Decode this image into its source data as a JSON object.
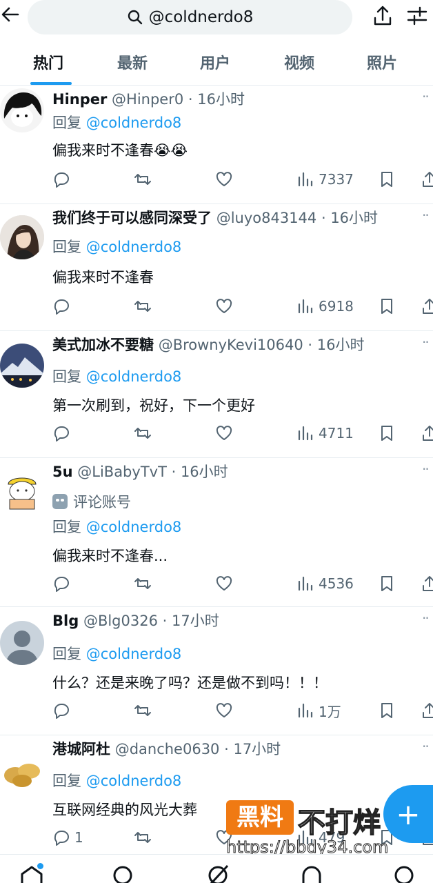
{
  "search": {
    "query": "@coldnerdo8"
  },
  "tabs": [
    "热门",
    "最新",
    "用户",
    "视频",
    "照片"
  ],
  "tweets": [
    {
      "name": "Hinper",
      "handle": "@Hinper0",
      "time": "16小时",
      "reply_prefix": "回复",
      "reply_to": "@coldnerdo8",
      "text": "偏我来时不逢春😭😭",
      "views": "7337",
      "replies": ""
    },
    {
      "name": "我们终于可以感同深受了",
      "handle": "@luyo843144",
      "time": "16小时",
      "reply_prefix": "回复",
      "reply_to": "@coldnerdo8",
      "text": "偏我来时不逢春",
      "views": "6918",
      "replies": ""
    },
    {
      "name": "美式加冰不要糖",
      "handle": "@BrownyKevi10640",
      "time": "16小时",
      "reply_prefix": "回复",
      "reply_to": "@coldnerdo8",
      "text": "第一次刷到，祝好，下一个更好",
      "views": "4711",
      "replies": ""
    },
    {
      "name": "5u",
      "handle": "@LiBabyTvT",
      "time": "16小时",
      "label": "评论账号",
      "reply_prefix": "回复",
      "reply_to": "@coldnerdo8",
      "text": "偏我来时不逢春...",
      "views": "4536",
      "replies": ""
    },
    {
      "name": "Blg",
      "handle": "@Blg0326",
      "time": "17小时",
      "reply_prefix": "回复",
      "reply_to": "@coldnerdo8",
      "text": "什么？还是来晚了吗？还是做不到吗！！！",
      "views": "1万",
      "replies": ""
    },
    {
      "name": "港城阿杜",
      "handle": "@danche0630",
      "time": "17小时",
      "reply_prefix": "回复",
      "reply_to": "@coldnerdo8",
      "text": "互联网经典的风光大葬",
      "views": "479",
      "replies": "1"
    }
  ],
  "fab": {
    "label": "+"
  },
  "watermark": {
    "box": "黑料",
    "big": "不打烊",
    "url": "https://bbdy34.com"
  },
  "icons": {
    "back": "back-arrow-icon",
    "search": "search-icon",
    "share": "share-icon",
    "filter": "filter-sliders-icon",
    "reply": "reply-icon",
    "retweet": "retweet-icon",
    "like": "heart-icon",
    "views": "views-bar-icon",
    "bookmark": "bookmark-icon",
    "more": "more-dots-icon"
  },
  "colors": {
    "accent": "#1d9bf0",
    "secondary_text": "#536471",
    "watermark": "#f07a13"
  }
}
